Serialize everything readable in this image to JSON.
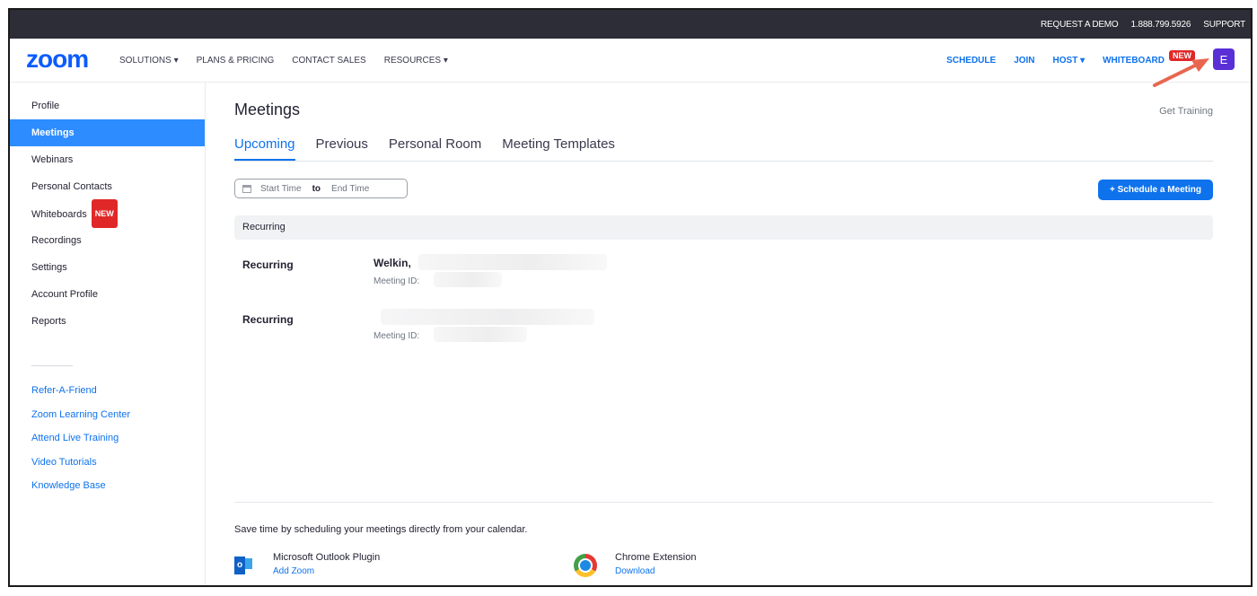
{
  "topbar": {
    "request_demo": "REQUEST A DEMO",
    "phone": "1.888.799.5926",
    "support": "SUPPORT"
  },
  "nav": {
    "logo": "zoom",
    "left": [
      "SOLUTIONS ▾",
      "PLANS & PRICING",
      "CONTACT SALES",
      "RESOURCES ▾"
    ],
    "schedule": "SCHEDULE",
    "join": "JOIN",
    "host": "HOST ▾",
    "whiteboard": "WHITEBOARD",
    "new_badge": "NEW",
    "avatar": "E"
  },
  "sidebar": {
    "items": [
      "Profile",
      "Meetings",
      "Webinars",
      "Personal Contacts",
      "Whiteboards",
      "Recordings",
      "Settings",
      "Account Profile",
      "Reports"
    ],
    "active": "Meetings",
    "new_badge": "NEW",
    "links": [
      "Refer-A-Friend",
      "Zoom Learning Center",
      "Attend Live Training",
      "Video Tutorials",
      "Knowledge Base"
    ]
  },
  "main": {
    "title": "Meetings",
    "get_training": "Get Training",
    "tabs": [
      "Upcoming",
      "Previous",
      "Personal Room",
      "Meeting Templates"
    ],
    "active_tab": "Upcoming",
    "date_range": {
      "start": "Start Time",
      "to": "to",
      "end": "End Time"
    },
    "schedule_button": "+  Schedule a Meeting",
    "section_header": "Recurring",
    "meetings": [
      {
        "type": "Recurring",
        "title": "Welkin,",
        "id_label": "Meeting ID:"
      },
      {
        "type": "Recurring",
        "title": "",
        "id_label": "Meeting ID:"
      }
    ],
    "promo_text": "Save time by scheduling your meetings directly from your calendar.",
    "plugins": [
      {
        "name": "Microsoft Outlook Plugin",
        "link": "Add Zoom",
        "icon": "outlook-icon"
      },
      {
        "name": "Chrome Extension",
        "link": "Download",
        "icon": "chrome-icon"
      }
    ]
  },
  "colors": {
    "brand": "#0b5cff",
    "accent": "#0e72ed",
    "active_sidebar": "#2d8cff",
    "badge": "#e02828",
    "avatar": "#5a2fd6",
    "arrow": "#e8664f"
  }
}
